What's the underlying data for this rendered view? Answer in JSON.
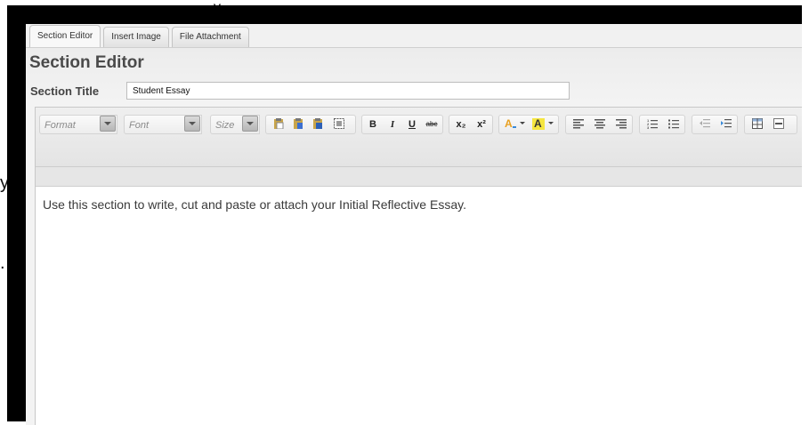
{
  "background_text": {
    "line_a": "y",
    "line_b": ".",
    "top_fragment": "y"
  },
  "tabs": [
    {
      "label": "Section Editor",
      "active": true
    },
    {
      "label": "Insert Image",
      "active": false
    },
    {
      "label": "File Attachment",
      "active": false
    }
  ],
  "panel": {
    "heading": "Section Editor",
    "title_label": "Section Title",
    "title_value": "Student Essay"
  },
  "toolbar": {
    "format_label": "Format",
    "font_label": "Font",
    "size_label": "Size",
    "bold": "B",
    "italic": "I",
    "underline": "U",
    "strike": "abc",
    "subscript": "x₂",
    "superscript": "x²"
  },
  "editor": {
    "content_text": "Use this section to write, cut and paste or attach your Initial Reflective Essay."
  },
  "colors": {
    "frame": "#000000",
    "highlight_yellow": "#f5e640",
    "text_color_accent": "#e8a020"
  }
}
